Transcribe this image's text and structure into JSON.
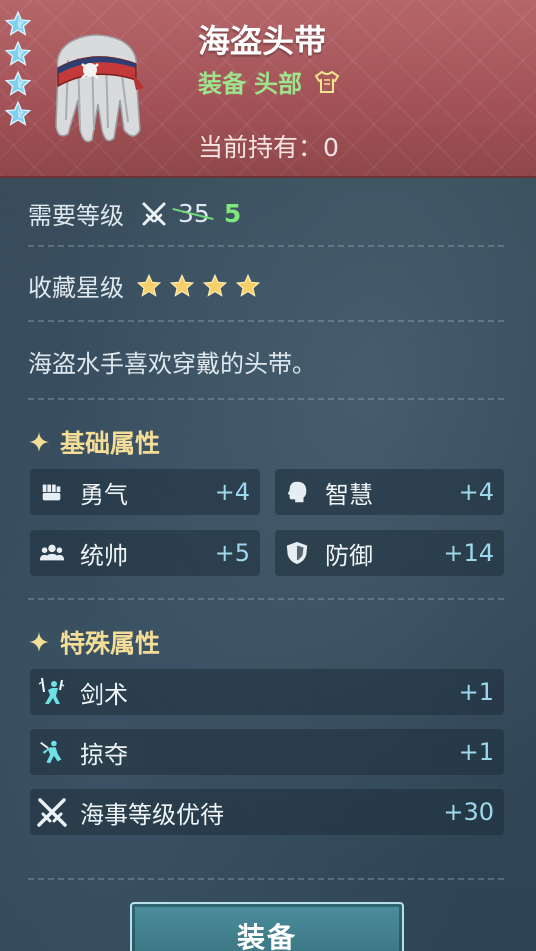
{
  "item": {
    "name": "海盗头带",
    "type_category": "装备",
    "type_slot": "头部",
    "owned_label": "当前持有：",
    "owned_count": "0",
    "rarity_stars": 4
  },
  "requirements": {
    "level_label": "需要等级",
    "level_old": "35",
    "level_new": "5",
    "collect_label": "收藏星级",
    "collect_stars": 4
  },
  "description": "海盗水手喜欢穿戴的头带。",
  "basic_section": {
    "title": "基础属性",
    "stats": [
      {
        "name": "勇气",
        "value": "+4",
        "icon": "fist-icon"
      },
      {
        "name": "智慧",
        "value": "+4",
        "icon": "head-icon"
      },
      {
        "name": "统帅",
        "value": "+5",
        "icon": "group-icon"
      },
      {
        "name": "防御",
        "value": "+14",
        "icon": "shield-icon"
      }
    ]
  },
  "special_section": {
    "title": "特殊属性",
    "stats": [
      {
        "name": "剑术",
        "value": "+1",
        "icon": "swordsman-icon"
      },
      {
        "name": "掠夺",
        "value": "+1",
        "icon": "plunder-icon"
      },
      {
        "name": "海事等级优待",
        "value": "+30",
        "icon": "crossed-swords-icon"
      }
    ]
  },
  "equip_button": "装备",
  "colors": {
    "header": "#a25256",
    "accent_green": "#9ee48c",
    "section_gold": "#f4dd97",
    "stat_value": "#9ed8ec"
  }
}
